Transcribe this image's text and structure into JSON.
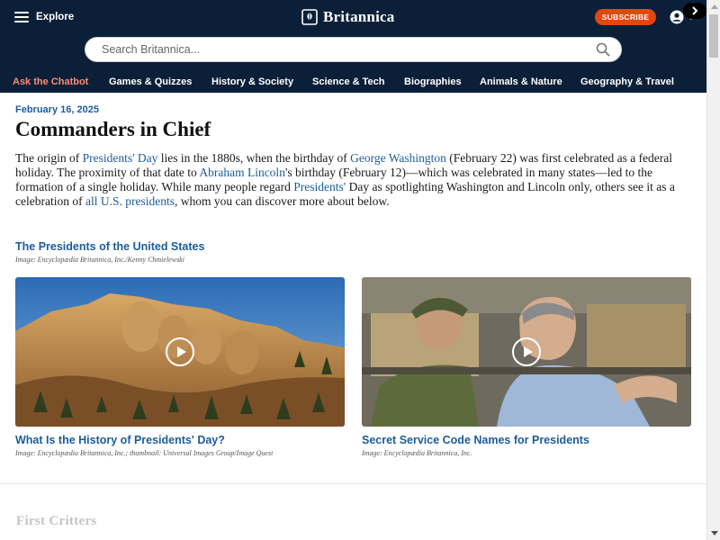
{
  "header": {
    "explore_label": "Explore",
    "brand_name": "Britannica",
    "subscribe_label": "SUBSCRIBE",
    "search_placeholder": "Search Britannica...",
    "nav_items": [
      {
        "label": "Ask the Chatbot",
        "accent": "#ff8a73"
      },
      {
        "label": "Games & Quizzes"
      },
      {
        "label": "History & Society"
      },
      {
        "label": "Science & Tech"
      },
      {
        "label": "Biographies"
      },
      {
        "label": "Animals & Nature"
      },
      {
        "label": "Geography & Travel"
      }
    ],
    "colors": {
      "background": "#0b2038",
      "subscribe": "#e0480e"
    }
  },
  "article": {
    "date": "February 16, 2025",
    "title": "Commanders in Chief",
    "body": [
      {
        "t": "The origin of "
      },
      {
        "t": "Presidents' Day",
        "link": true
      },
      {
        "t": " lies in the 1880s, when the birthday of "
      },
      {
        "t": "George Washington",
        "link": true
      },
      {
        "t": " (February 22) was first celebrated as a federal holiday. The proximity of that date to "
      },
      {
        "t": "Abraham Lincoln",
        "link": true
      },
      {
        "t": "'s birthday (February 12)—which was celebrated in many states—led to the formation of a single holiday. While many people regard "
      },
      {
        "t": "Presidents'",
        "link": true
      },
      {
        "t": " Day as spotlighting Washington and Lincoln only, others see it as a celebration of "
      },
      {
        "t": "all U.S. presidents",
        "link": true
      },
      {
        "t": ", whom you can discover more about below."
      }
    ],
    "link_color": "#1b5c9e",
    "section": {
      "title": "The Presidents of the United States",
      "credit": "Image: Encyclopædia Britannica, Inc./Kenny Chmielewski"
    },
    "videos": [
      {
        "title": "What Is the History of Presidents' Day?",
        "credit": "Image: Encyclopædia Britannica, Inc.; thumbnail: Universal Images Group/Image Quest",
        "thumb_icon": "mount-rushmore-image"
      },
      {
        "title": "Secret Service Code Names for Presidents",
        "credit": "Image: Encyclopædia Britannica, Inc.",
        "thumb_icon": "president-in-vehicle-image"
      }
    ],
    "next_section_title": "First Critters"
  }
}
